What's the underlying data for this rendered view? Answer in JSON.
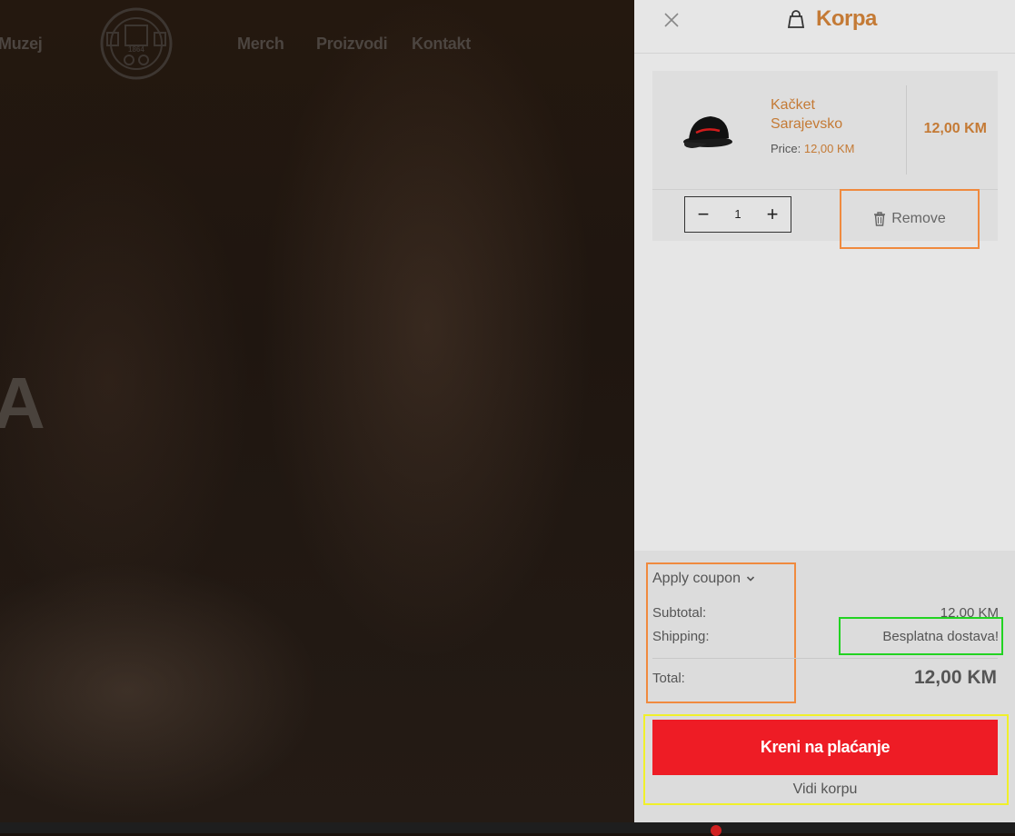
{
  "nav": {
    "items": [
      "Muzej",
      "Merch",
      "Proizvodi",
      "Kontakt"
    ]
  },
  "logo": {
    "year": "1864"
  },
  "hero": {
    "partial_letter": "A"
  },
  "cart": {
    "title": "Korpa",
    "item": {
      "name": "Kačket Sarajevsko",
      "price_label": "Price:",
      "price_value": "12,00 KM",
      "line_total": "12,00 KM",
      "quantity": "1",
      "minus": "−",
      "plus": "+",
      "remove_label": "Remove"
    },
    "totals": {
      "coupon_label": "Apply coupon",
      "subtotal_label": "Subtotal:",
      "subtotal_value": "12,00 KM",
      "shipping_label": "Shipping:",
      "shipping_value": "Besplatna dostava!",
      "total_label": "Total:",
      "total_value": "12,00 KM"
    },
    "checkout_label": "Kreni na plaćanje",
    "view_cart_label": "Vidi korpu"
  },
  "colors": {
    "accent": "#c47a35",
    "checkout": "#ee1c25",
    "drawer_bg": "#e6e6e6",
    "highlight_orange": "#f08a3e",
    "highlight_green": "#22d322",
    "highlight_yellow": "#f0f02a"
  },
  "icons": {
    "close": "close-icon",
    "bag": "shopping-bag-icon",
    "trash": "trash-icon",
    "chevron": "chevron-down-icon"
  }
}
